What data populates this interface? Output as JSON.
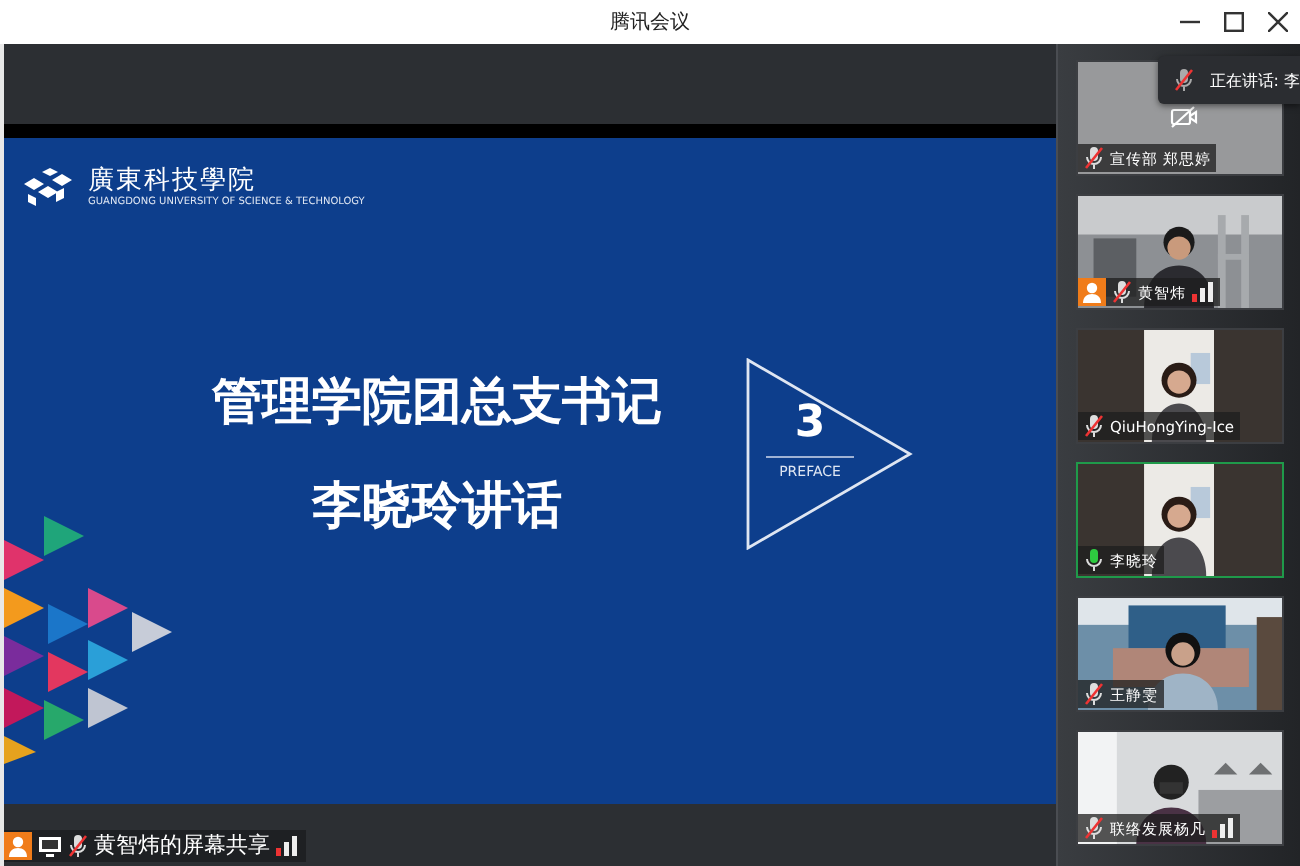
{
  "window": {
    "title": "腾讯会议"
  },
  "speaking_toast": {
    "label": "正在讲话: 李"
  },
  "slide": {
    "school_name": "廣東科技學院",
    "school_subtitle": "GUANGDONG UNIVERSITY OF SCIENCE & TECHNOLOGY",
    "title_lines": [
      "管理学院团总支书记",
      "李晓玲讲话"
    ],
    "section_number": "3",
    "section_label": "PREFACE"
  },
  "screen_share": {
    "label": "黄智炜的屏幕共享",
    "host": true,
    "muted": true,
    "network_icon": true
  },
  "participants": [
    {
      "name": "宣传部 郑思婷",
      "muted": true,
      "camera_on": false,
      "host": false,
      "network_icon": false,
      "active": false
    },
    {
      "name": "黄智炜",
      "muted": true,
      "camera_on": true,
      "host": true,
      "network_icon": true,
      "active": false
    },
    {
      "name": "QiuHongYing-Ice",
      "muted": true,
      "camera_on": true,
      "host": false,
      "network_icon": false,
      "active": false
    },
    {
      "name": "李晓玲",
      "muted": false,
      "camera_on": true,
      "host": false,
      "network_icon": false,
      "active": true
    },
    {
      "name": "王静雯",
      "muted": true,
      "camera_on": true,
      "host": false,
      "network_icon": false,
      "active": false
    },
    {
      "name": "联络发展杨凡",
      "muted": true,
      "camera_on": true,
      "host": false,
      "network_icon": true,
      "active": false
    }
  ]
}
